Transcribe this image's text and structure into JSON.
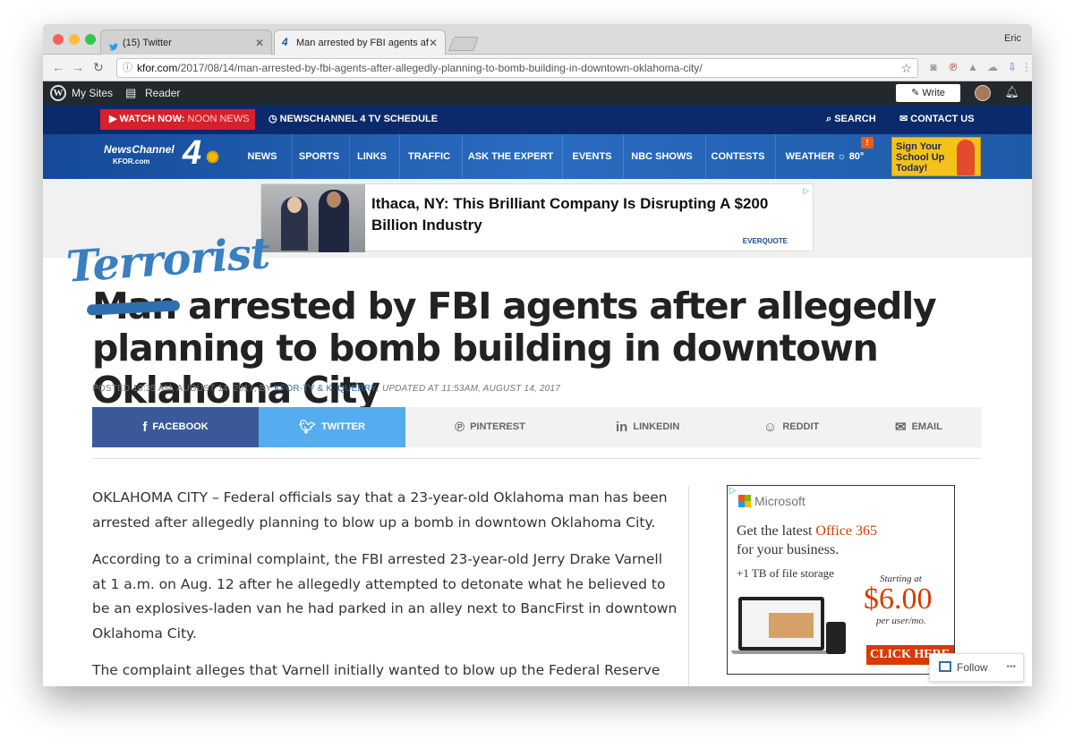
{
  "browser": {
    "user": "Eric",
    "tabs": [
      {
        "label": "(15) Twitter"
      },
      {
        "label": "Man arrested by FBI agents af"
      }
    ],
    "url_host": "kfor.com",
    "url_path": "/2017/08/14/man-arrested-by-fbi-agents-after-allegedly-planning-to-bomb-building-in-downtown-oklahoma-city/"
  },
  "wpbar": {
    "my_sites": "My Sites",
    "reader": "Reader",
    "write": "Write"
  },
  "topnav": {
    "watch_label": "WATCH NOW:",
    "watch_program": "NOON NEWS",
    "schedule": "NEWSCHANNEL 4 TV SCHEDULE",
    "search": "SEARCH",
    "contact": "CONTACT US"
  },
  "logo": {
    "name": "NewsChannel",
    "number": "4",
    "site": "KFOR.com"
  },
  "mainnav": {
    "items": [
      "NEWS",
      "SPORTS",
      "LINKS",
      "TRAFFIC",
      "ASK THE EXPERT",
      "EVENTS",
      "NBC SHOWS",
      "CONTESTS",
      "WEATHER"
    ],
    "temperature": "80°",
    "promo": "Sign Your School Up Today!"
  },
  "banner_ad": {
    "title": "Ithaca, NY: This Brilliant Company Is Disrupting A $200 Billion Industry",
    "brand": "EVERQUOTE"
  },
  "article": {
    "overlay_word": "Terrorist",
    "struck_word": "Man",
    "headline_rest": " arrested by FBI agents after allegedly planning to bomb building in downtown Oklahoma City",
    "meta_posted": "POSTED 10:35 AM, AUGUST 14, 2017, BY ",
    "meta_authors": "KFOR-TV & K. QUERRY",
    "meta_updated": ", UPDATED AT 11:53AM, AUGUST 14, 2017",
    "paragraphs": [
      "OKLAHOMA CITY – Federal officials say that a 23-year-old Oklahoma man has been arrested after allegedly planning to blow up a bomb in downtown Oklahoma City.",
      "According to a criminal complaint, the FBI arrested 23-year-old Jerry Drake Varnell at 1 a.m. on Aug. 12 after he allegedly attempted to detonate what he believed to be an explosives-laden van he had parked in an alley next to BancFirst in downtown Oklahoma City.",
      "The complaint alleges that Varnell initially wanted to blow up the Federal Reserve"
    ]
  },
  "share": {
    "facebook": "FACEBOOK",
    "twitter": "TWITTER",
    "pinterest": "PINTEREST",
    "linkedin": "LINKEDIN",
    "reddit": "REDDIT",
    "email": "EMAIL"
  },
  "side_ad": {
    "brand": "Microsoft",
    "line1": "Get the latest",
    "product": "Office 365",
    "line2": "for your business.",
    "line3": "+1 TB of file storage",
    "starting": "Starting at",
    "price": "$6.00",
    "per": "per user/mo.",
    "cta": "CLICK HERE"
  },
  "follow": {
    "label": "Follow",
    "more": "•••"
  },
  "colors": {
    "site_navy": "#0b2a6b",
    "site_blue": "#1e5aa8",
    "watch_red": "#d8202a",
    "facebook": "#3b5998",
    "twitter": "#55acee",
    "overlay_blue": "#3a7fc0"
  }
}
